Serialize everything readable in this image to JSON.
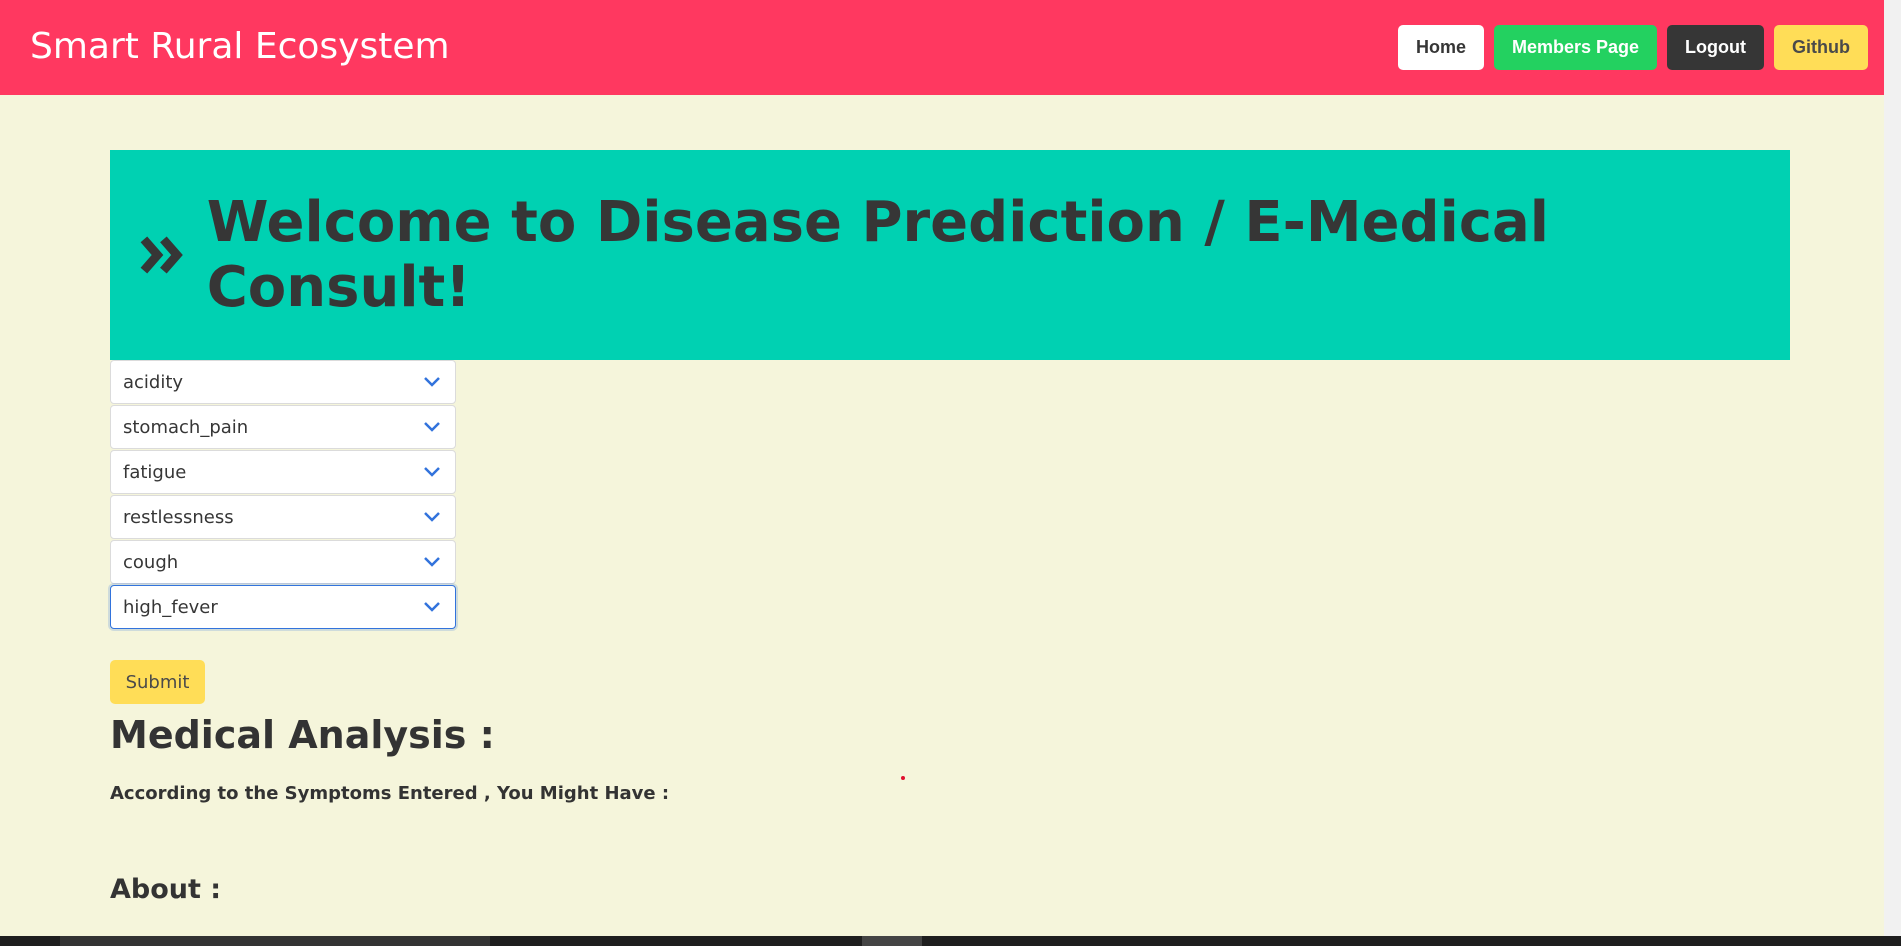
{
  "nav": {
    "brand": "Smart Rural Ecosystem",
    "buttons": [
      "Home",
      "Members Page",
      "Logout",
      "Github"
    ]
  },
  "hero": {
    "title": "Welcome to Disease Prediction / E-Medical Consult!"
  },
  "symptoms": [
    "acidity",
    "stomach_pain",
    "fatigue",
    "restlessness",
    "cough",
    "high_fever"
  ],
  "submit_label": "Submit",
  "analysis": {
    "title": "Medical Analysis :",
    "subtitle": "According to the Symptoms Entered , You Might Have :"
  },
  "about": {
    "title": "About :"
  },
  "colors": {
    "nav": "#ff3860",
    "hero": "#00d1b2",
    "background": "#f5f5db",
    "accent": "#3273dc"
  }
}
